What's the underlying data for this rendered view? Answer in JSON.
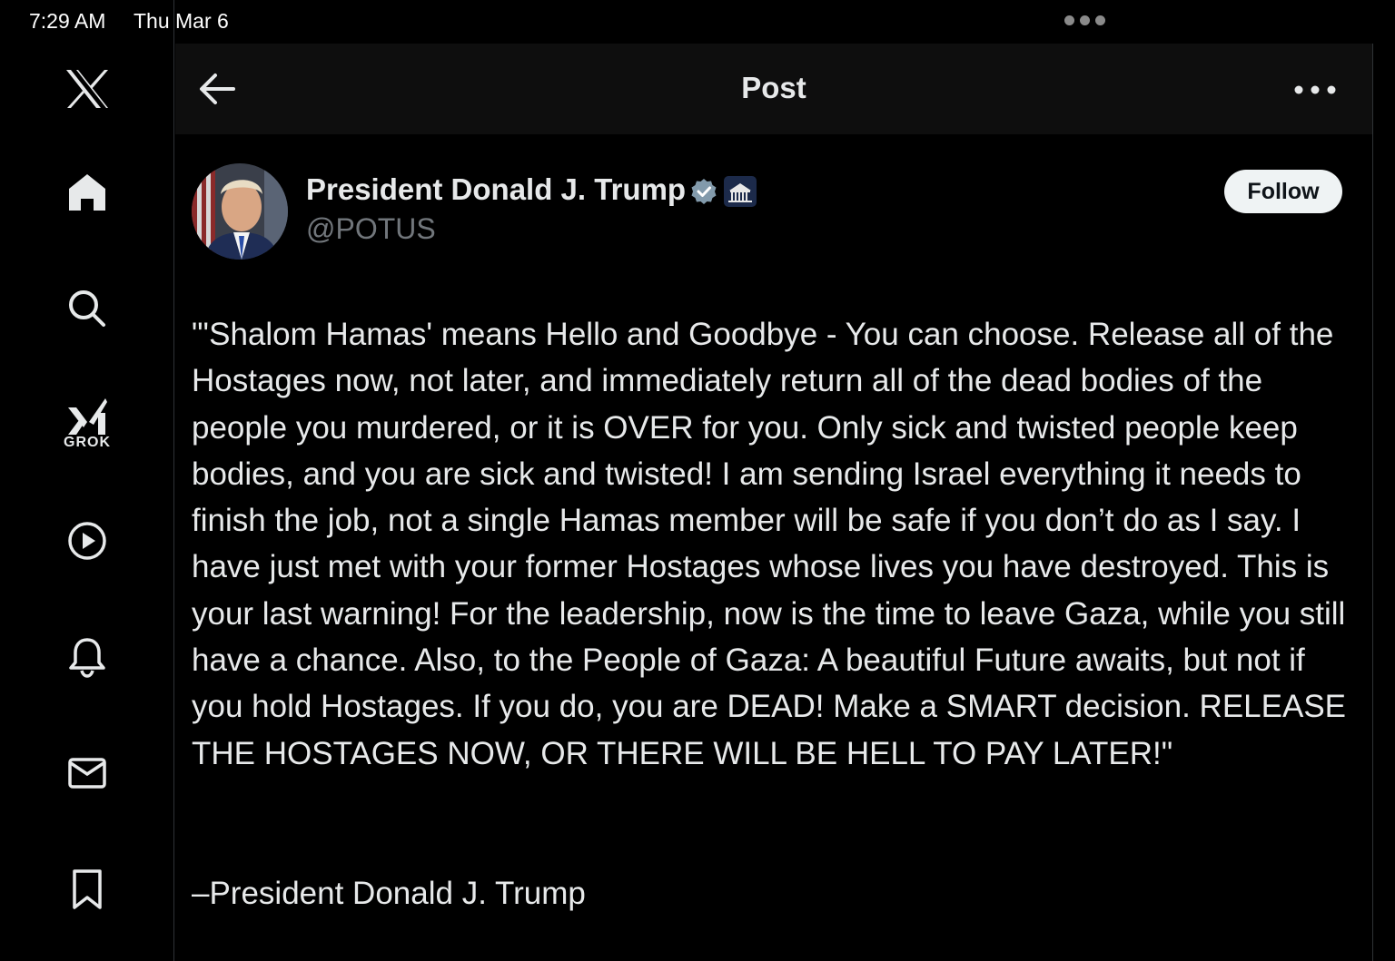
{
  "status_bar": {
    "time": "7:29 AM",
    "date": "Thu Mar 6"
  },
  "sidebar": {
    "items": [
      {
        "icon": "x-logo-icon"
      },
      {
        "icon": "home-icon"
      },
      {
        "icon": "search-icon"
      },
      {
        "icon": "grok-icon",
        "label": "GROK"
      },
      {
        "icon": "video-play-icon"
      },
      {
        "icon": "notifications-bell-icon"
      },
      {
        "icon": "messages-envelope-icon"
      },
      {
        "icon": "bookmark-icon"
      }
    ]
  },
  "header": {
    "title": "Post"
  },
  "post": {
    "author_name": "President Donald J. Trump",
    "author_handle": "@POTUS",
    "follow_label": "Follow",
    "body": "\"'Shalom Hamas' means Hello and Goodbye - You can choose. Release all of the Hostages now, not later, and immediately return all of the dead bodies of the people you murdered, or it is OVER for you. Only sick and twisted people keep bodies, and you are sick and twisted! I am sending Israel everything it needs to finish the job, not a single Hamas member will be safe if you don’t do as I say. I have just met with your former Hostages whose lives you have destroyed. This is your last warning! For the leadership, now is the time to leave Gaza, while you still have a chance. Also, to the People of Gaza: A beautiful Future awaits, but not if you hold Hostages. If you do, you are DEAD! Make a SMART decision. RELEASE THE HOSTAGES NOW, OR THERE WILL BE HELL TO PAY LATER!\"",
    "signature": "–President Donald J. Trump"
  },
  "colors": {
    "background": "#000000",
    "text": "#e7e9ea",
    "secondary_text": "#71767b",
    "verified_badge": "#829aab",
    "follow_button_bg": "#eff3f4"
  }
}
